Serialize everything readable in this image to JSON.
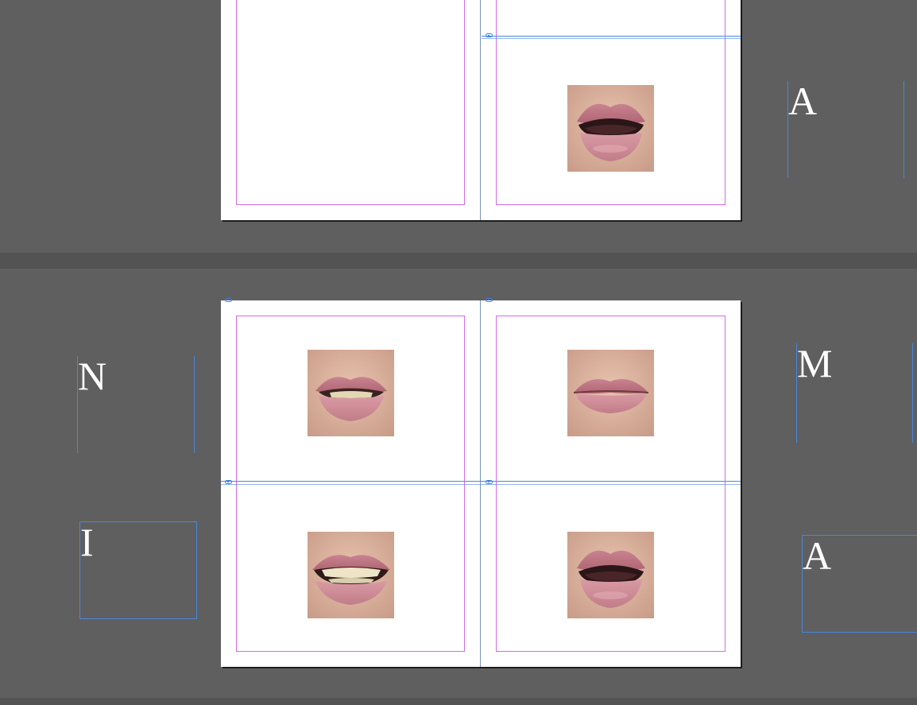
{
  "canvas": {
    "background": "#5f5f5f",
    "page_color": "#ffffff",
    "margin_guide_color": "#d36be6",
    "frame_color": "#4a86de"
  },
  "letters": {
    "top_right": "A",
    "left_upper": "N",
    "left_lower": "I",
    "right_upper": "M",
    "right_lower": "A"
  },
  "photos": {
    "top_right_page": "mouth-open-icon",
    "bottom_left_upper": "mouth-teeth-slight-icon",
    "bottom_right_upper": "mouth-closed-icon",
    "bottom_left_lower": "mouth-smile-teeth-icon",
    "bottom_right_lower": "mouth-open-icon"
  }
}
